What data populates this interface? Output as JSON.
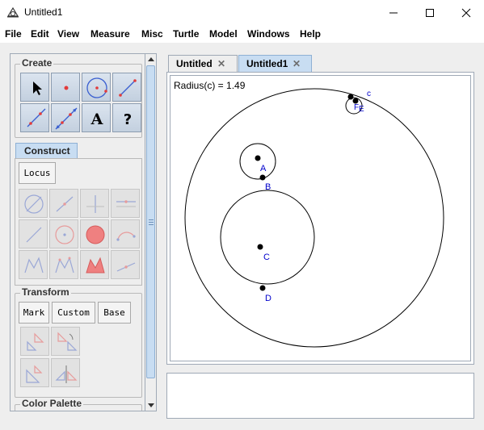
{
  "window": {
    "title": "Untitled1"
  },
  "menus": [
    "File",
    "Edit",
    "View",
    "Measure",
    "Misc",
    "Turtle",
    "Model",
    "Windows",
    "Help"
  ],
  "panel": {
    "create_title": "Create",
    "construct_tab": "Construct",
    "locus_button": "Locus",
    "transform_title": "Transform",
    "transform_buttons": [
      "Mark",
      "Custom",
      "Base"
    ],
    "palette_title": "Color Palette",
    "text_tool_glyph": "A",
    "help_tool_glyph": "?"
  },
  "tabs": [
    {
      "label": "Untitled",
      "active": false
    },
    {
      "label": "Untitled1",
      "active": true
    }
  ],
  "close_glyph": "✕",
  "canvas": {
    "measurement": "Radius(c) = 1.49",
    "point_labels": {
      "A": "A",
      "B": "B",
      "C": "C",
      "D": "D",
      "c": "c",
      "F": "F",
      "E": "E"
    }
  },
  "colors": {
    "accent": "#c8ddf2",
    "point_label": "#0000cc",
    "tool_red": "#e23b3b",
    "tool_blue": "#3a5fd0"
  }
}
